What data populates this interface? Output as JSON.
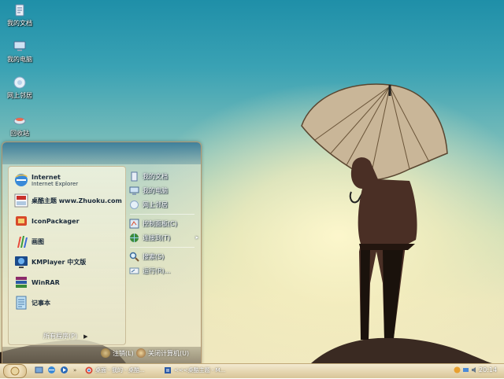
{
  "desktop": {
    "icons": [
      {
        "label": "我的文档",
        "icon": "my-documents-icon"
      },
      {
        "label": "我的电脑",
        "icon": "my-computer-icon"
      },
      {
        "label": "网上邻居",
        "icon": "network-places-icon"
      },
      {
        "label": "回收站",
        "icon": "recycle-bin-icon"
      }
    ]
  },
  "start_menu": {
    "programs": [
      {
        "title": "Internet",
        "subtitle": "Internet Explorer",
        "icon": "internet-explorer-icon"
      },
      {
        "title": "桌酷主题 www.Zhuoku.com",
        "icon": "zhuoku-theme-icon"
      },
      {
        "title": "IconPackager",
        "icon": "iconpackager-icon"
      },
      {
        "title": "画图",
        "icon": "paint-icon"
      },
      {
        "title": "KMPlayer 中文版",
        "icon": "kmplayer-icon"
      },
      {
        "title": "WinRAR",
        "icon": "winrar-icon"
      },
      {
        "title": "记事本",
        "icon": "notepad-icon"
      }
    ],
    "places": [
      {
        "label": "我的文档",
        "icon": "my-documents-icon"
      },
      {
        "label": "我的电脑",
        "icon": "my-computer-icon"
      },
      {
        "label": "网上邻居",
        "icon": "network-places-icon"
      },
      {
        "label": "控制面板(C)",
        "icon": "control-panel-icon"
      },
      {
        "label": "连接到(T)",
        "icon": "connect-to-icon",
        "arrow": "▸"
      },
      {
        "label": "搜索(S)",
        "icon": "search-icon"
      },
      {
        "label": "运行(R)...",
        "icon": "run-icon"
      }
    ],
    "all_programs": "所有程序(P)",
    "all_programs_arrow": "▶",
    "logoff": "注销(L)",
    "shutdown": "关闭计算机(U)"
  },
  "taskbar": {
    "tasks": [
      {
        "label": "桌面 - 我的 - 桌酷...",
        "icon": "chrome-icon"
      },
      {
        "label": "<<<桌酷主题 - M...",
        "icon": "word-doc-icon"
      }
    ],
    "quicklaunch_more": "»",
    "clock": "20:14"
  },
  "colors": {
    "sky_top": "#1f8fa8",
    "sky_bottom": "#f1e8c0",
    "taskbar": "#e6d7b2"
  }
}
